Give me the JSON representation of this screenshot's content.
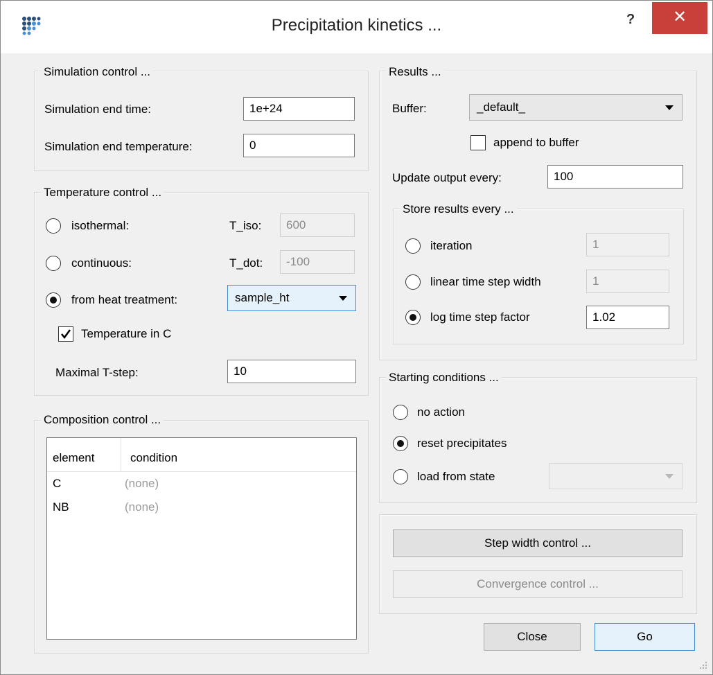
{
  "window": {
    "title": "Precipitation kinetics ...",
    "help": "?",
    "close_glyph": "✕"
  },
  "simulation_control": {
    "title": "Simulation control ...",
    "end_time_label": "Simulation end time:",
    "end_time_value": "1e+24",
    "end_temp_label": "Simulation end temperature:",
    "end_temp_value": "0"
  },
  "temperature_control": {
    "title": "Temperature control ...",
    "isothermal_label": "isothermal:",
    "t_iso_label": "T_iso:",
    "t_iso_value": "600",
    "continuous_label": "continuous:",
    "t_dot_label": "T_dot:",
    "t_dot_value": "-100",
    "heat_treatment_label": "from heat treatment:",
    "heat_treatment_value": "sample_ht",
    "temp_in_c_label": "Temperature in C",
    "max_tstep_label": "Maximal T-step:",
    "max_tstep_value": "10"
  },
  "composition_control": {
    "title": "Composition control ...",
    "columns": [
      "element",
      "condition"
    ],
    "rows": [
      {
        "element": "C",
        "condition": "(none)"
      },
      {
        "element": "NB",
        "condition": "(none)"
      }
    ]
  },
  "results": {
    "title": "Results ...",
    "buffer_label": "Buffer:",
    "buffer_value": "_default_",
    "append_label": "append to buffer",
    "update_label": "Update output every:",
    "update_value": "100",
    "store_title": "Store results every ...",
    "iteration_label": "iteration",
    "iteration_value": "1",
    "linear_label": "linear time step width",
    "linear_value": "1",
    "log_label": "log time step factor",
    "log_value": "1.02"
  },
  "starting_conditions": {
    "title": "Starting conditions ...",
    "no_action_label": "no action",
    "reset_label": "reset precipitates",
    "load_label": "load from state",
    "load_value": ""
  },
  "buttons": {
    "step_width": "Step width control ...",
    "convergence": "Convergence control ...",
    "close": "Close",
    "go": "Go"
  }
}
